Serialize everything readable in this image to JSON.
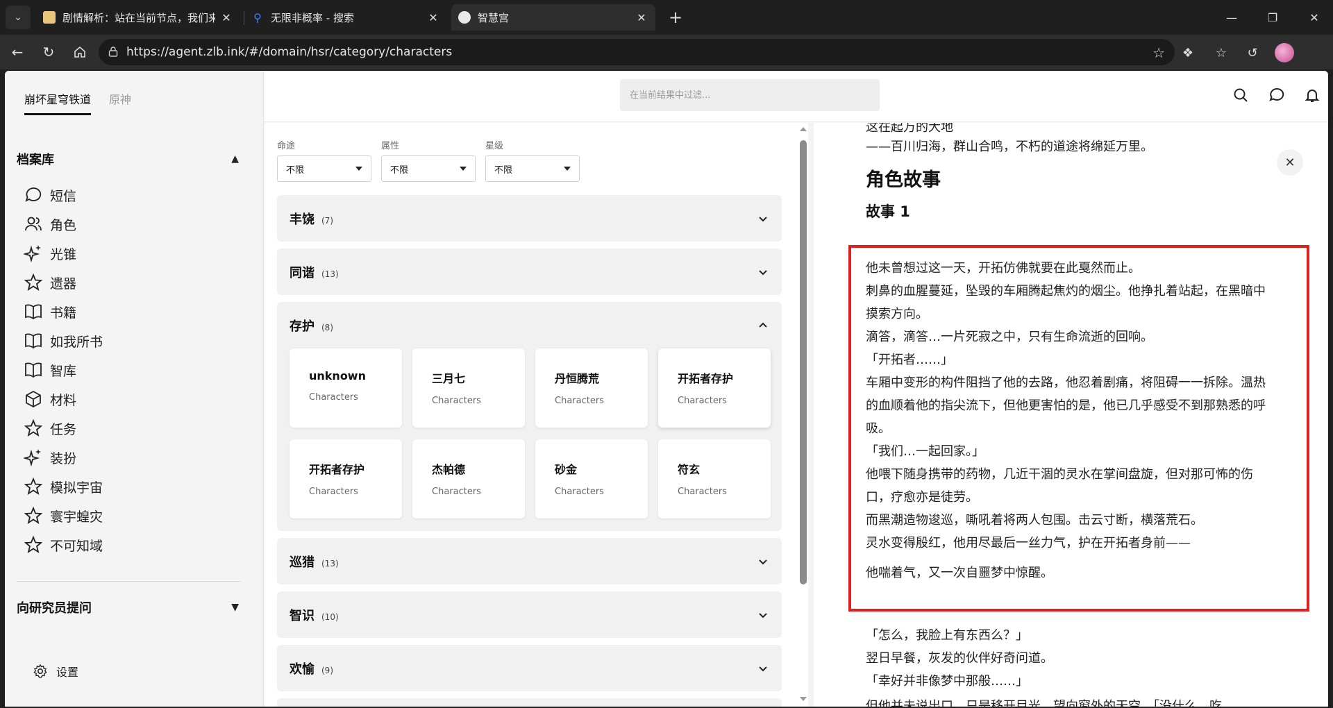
{
  "browser": {
    "tabs": [
      {
        "title": "剧情解析：站在当前节点，我们来",
        "active": false
      },
      {
        "title": "无限非概率 - 搜索",
        "active": false
      },
      {
        "title": "智慧宫",
        "active": true
      }
    ],
    "url": "https://agent.zlb.ink/#/domain/hsr/category/characters"
  },
  "sidebar": {
    "game_tabs": [
      "崩坏星穹铁道",
      "原神"
    ],
    "archive_title": "档案库",
    "items": [
      {
        "label": "短信",
        "icon": "chat-icon"
      },
      {
        "label": "角色",
        "icon": "users-icon"
      },
      {
        "label": "光锥",
        "icon": "sparkle-icon"
      },
      {
        "label": "遗器",
        "icon": "star-icon"
      },
      {
        "label": "书籍",
        "icon": "book-icon"
      },
      {
        "label": "如我所书",
        "icon": "book-icon"
      },
      {
        "label": "智库",
        "icon": "book-icon"
      },
      {
        "label": "材料",
        "icon": "cube-icon"
      },
      {
        "label": "任务",
        "icon": "star-icon"
      },
      {
        "label": "装扮",
        "icon": "sparkle-icon"
      },
      {
        "label": "模拟宇宙",
        "icon": "star-icon"
      },
      {
        "label": "寰宇蝗灾",
        "icon": "star-icon"
      },
      {
        "label": "不可知域",
        "icon": "star-icon"
      }
    ],
    "ask_title": "向研究员提问",
    "settings_label": "设置"
  },
  "search": {
    "placeholder": "在当前结果中过滤..."
  },
  "filters": [
    {
      "label": "命途",
      "value": "不限"
    },
    {
      "label": "属性",
      "value": "不限"
    },
    {
      "label": "星级",
      "value": "不限"
    }
  ],
  "paths": [
    {
      "name": "丰饶",
      "count": "(7)",
      "expanded": false
    },
    {
      "name": "同谐",
      "count": "(13)",
      "expanded": false
    },
    {
      "name": "存护",
      "count": "(8)",
      "expanded": true
    },
    {
      "name": "巡猎",
      "count": "(13)",
      "expanded": false
    },
    {
      "name": "智识",
      "count": "(10)",
      "expanded": false
    },
    {
      "name": "欢愉",
      "count": "(9)",
      "expanded": false
    }
  ],
  "cards": [
    {
      "name": "unknown",
      "category": "Characters"
    },
    {
      "name": "三月七",
      "category": "Characters"
    },
    {
      "name": "丹恒腾荒",
      "category": "Characters"
    },
    {
      "name": "开拓者存护",
      "category": "Characters"
    },
    {
      "name": "开拓者存护",
      "category": "Characters"
    },
    {
      "name": "杰帕德",
      "category": "Characters"
    },
    {
      "name": "砂金",
      "category": "Characters"
    },
    {
      "name": "符玄",
      "category": "Characters"
    }
  ],
  "detail": {
    "top_cut": "这在起万的大地",
    "quote": "——百川归海，群山合鸣，不朽的道途将绵延万里。",
    "section_title": "角色故事",
    "story_title": "故事 1",
    "story_lines": [
      "他未曾想过这一天，开拓仿佛就要在此戛然而止。",
      "刺鼻的血腥蔓延，坠毁的车厢腾起焦灼的烟尘。他挣扎着站起，在黑暗中摸索方向。",
      "滴答，滴答…一片死寂之中，只有生命流逝的回响。",
      "「开拓者……」",
      "车厢中变形的构件阻挡了他的去路，他忍着剧痛，将阻碍一一拆除。温热的血顺着他的指尖流下，但他更害怕的是，他已几乎感受不到那熟悉的呼吸。",
      "「我们…一起回家。」",
      "他喂下随身携带的药物，几近干涸的灵水在掌间盘旋，但对那可怖的伤口，疗愈亦是徒劳。",
      "而黑潮造物逡巡，嘶吼着将两人包围。击云寸断，横落荒石。",
      "灵水变得殷红，他用尽最后一丝力气，护在开拓者身前——"
    ],
    "story_last": "他喘着气，又一次自噩梦中惊醒。",
    "after_lines": [
      "「怎么，我脸上有东西么？」",
      "翌日早餐，灰发的伙伴好奇问道。",
      "「幸好并非像梦中那般……」"
    ],
    "bottom_cut": "但他并未说出口，只是移开目光，望向窗外的天空。「没什么，吃"
  }
}
